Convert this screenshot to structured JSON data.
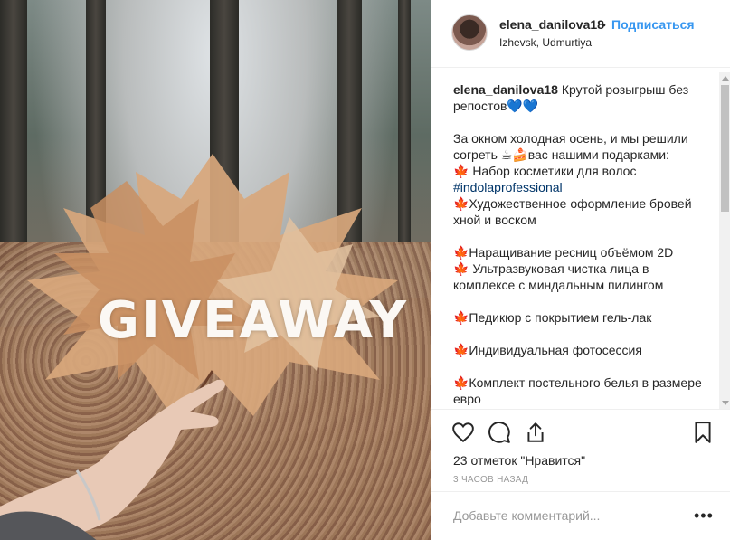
{
  "photo": {
    "overlay_text": "GIVEAWAY"
  },
  "header": {
    "username": "elena_danilova18",
    "separator": "•",
    "follow_label": "Подписаться",
    "location": "Izhevsk, Udmurtiya"
  },
  "caption": {
    "username": "elena_danilova18",
    "lines": [
      " Крутой розыгрыш без",
      "репостов💙💙",
      "",
      "За окном холодная осень, и мы решили",
      "согреть ☕🍰вас нашими подарками:",
      "🍁 Набор косметики для волос",
      "#indolaprofessional",
      "🍁Художественное оформление бровей",
      "хной и воском",
      "",
      "🍁Наращивание ресниц объёмом 2D",
      "🍁 Ультразвуковая чистка лица в",
      "комплексе с миндальным пилингом",
      "",
      "🍁Педикюр с покрытием гель-лак",
      "",
      "🍁Индивидуальная фотосессия",
      "",
      "🍁Комплект постельного белья в размере",
      "евро"
    ]
  },
  "actions": {
    "icons": [
      "heart-icon",
      "comment-icon",
      "share-icon",
      "bookmark-icon"
    ],
    "likes_text": "23 отметок \"Нравится\"",
    "time_text": "3 ЧАСОВ НАЗАД"
  },
  "comment": {
    "placeholder": "Добавьте комментарий...",
    "more_label": "•••"
  },
  "colors": {
    "accent": "#3897f0",
    "hashtag": "#003569",
    "muted": "#999999",
    "border": "#efefef"
  }
}
